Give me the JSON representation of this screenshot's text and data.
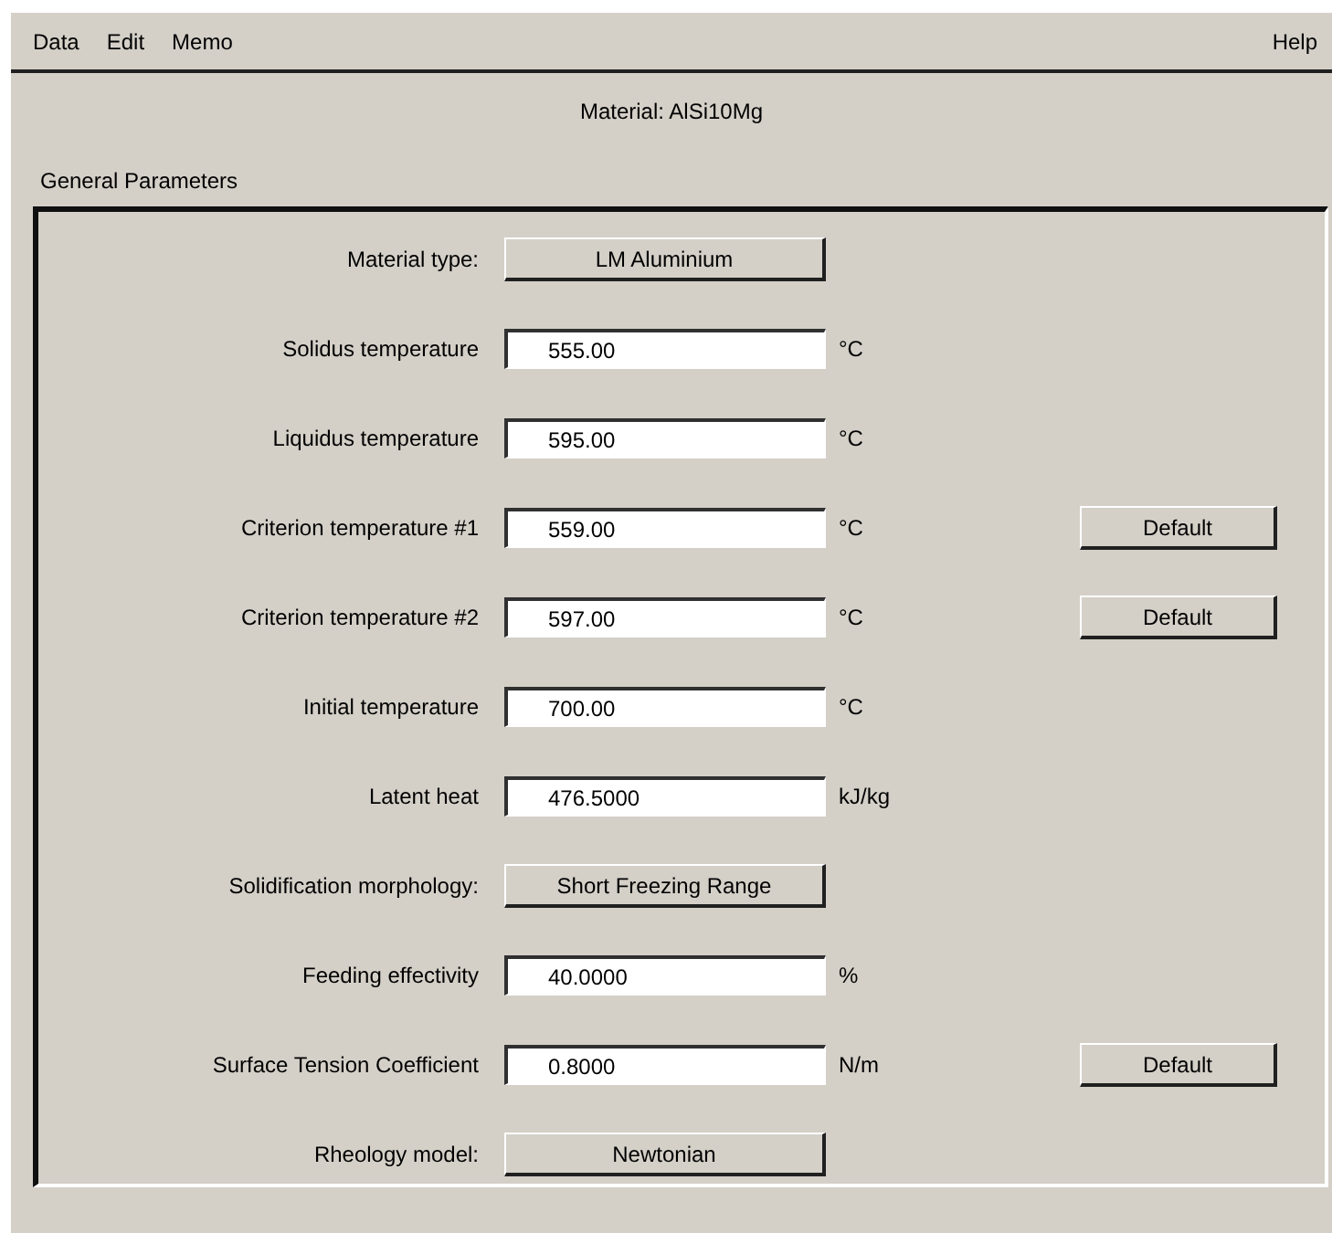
{
  "menu": {
    "left": [
      "Data",
      "Edit",
      "Memo"
    ],
    "right": [
      "Help"
    ]
  },
  "material_title": "Material: AlSi10Mg",
  "group_title": "General Parameters",
  "rows": [
    {
      "kind": "choice",
      "label": "Material type:",
      "value": "LM Aluminium"
    },
    {
      "kind": "field",
      "label": "Solidus temperature",
      "value": "555.00",
      "unit": "°C"
    },
    {
      "kind": "field",
      "label": "Liquidus temperature",
      "value": "595.00",
      "unit": "°C"
    },
    {
      "kind": "field",
      "label": "Criterion temperature #1",
      "value": "559.00",
      "unit": "°C",
      "action": "Default"
    },
    {
      "kind": "field",
      "label": "Criterion temperature #2",
      "value": "597.00",
      "unit": "°C",
      "action": "Default"
    },
    {
      "kind": "field",
      "label": "Initial temperature",
      "value": "700.00",
      "unit": "°C"
    },
    {
      "kind": "field",
      "label": "Latent heat",
      "value": "476.5000",
      "unit": "kJ/kg"
    },
    {
      "kind": "choice",
      "label": "Solidification morphology:",
      "value": "Short Freezing Range"
    },
    {
      "kind": "field",
      "label": "Feeding effectivity",
      "value": "40.0000",
      "unit": "%"
    },
    {
      "kind": "field",
      "label": "Surface Tension Coefficient",
      "value": "0.8000",
      "unit": "N/m",
      "action": "Default"
    },
    {
      "kind": "choice",
      "label": "Rheology model:",
      "value": "Newtonian"
    }
  ]
}
